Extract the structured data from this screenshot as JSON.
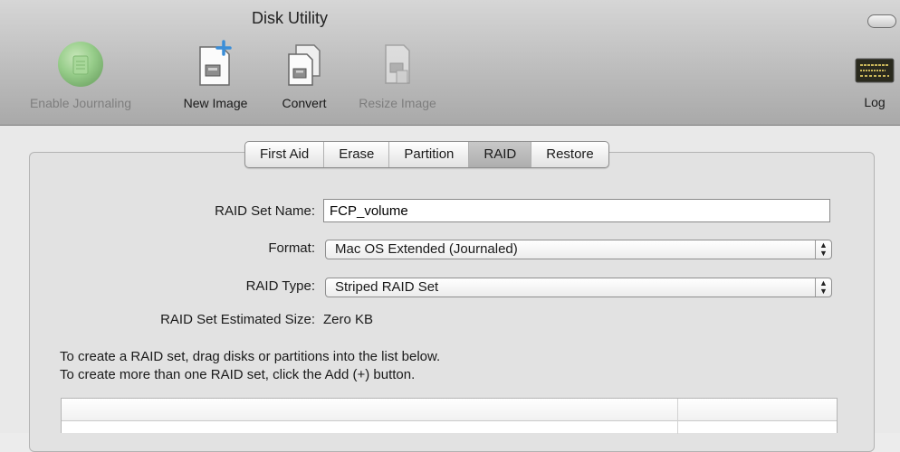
{
  "window": {
    "title": "Disk Utility"
  },
  "toolbar": {
    "items": [
      {
        "label": "Enable Journaling",
        "icon": "journaling-icon",
        "enabled": false
      },
      {
        "label": "New Image",
        "icon": "new-image-icon",
        "enabled": true
      },
      {
        "label": "Convert",
        "icon": "convert-icon",
        "enabled": true
      },
      {
        "label": "Resize Image",
        "icon": "resize-image-icon",
        "enabled": false
      }
    ],
    "log_label": "Log"
  },
  "tabs": [
    {
      "label": "First Aid",
      "active": false
    },
    {
      "label": "Erase",
      "active": false
    },
    {
      "label": "Partition",
      "active": false
    },
    {
      "label": "RAID",
      "active": true
    },
    {
      "label": "Restore",
      "active": false
    }
  ],
  "raid": {
    "name_label": "RAID Set Name:",
    "name_value": "FCP_volume",
    "format_label": "Format:",
    "format_value": "Mac OS Extended (Journaled)",
    "type_label": "RAID Type:",
    "type_value": "Striped RAID Set",
    "size_label": "RAID Set Estimated Size:",
    "size_value": "Zero KB",
    "instructions": [
      "To create a RAID set, drag disks or partitions into the list below.",
      "To create more than one RAID set, click the Add (+) button."
    ]
  },
  "colors": {
    "toolbar_top": "#d6d6d6",
    "toolbar_bottom": "#a9a9a9",
    "active_tab": "#b8b8b8",
    "disabled_text": "#7e7e7e"
  }
}
